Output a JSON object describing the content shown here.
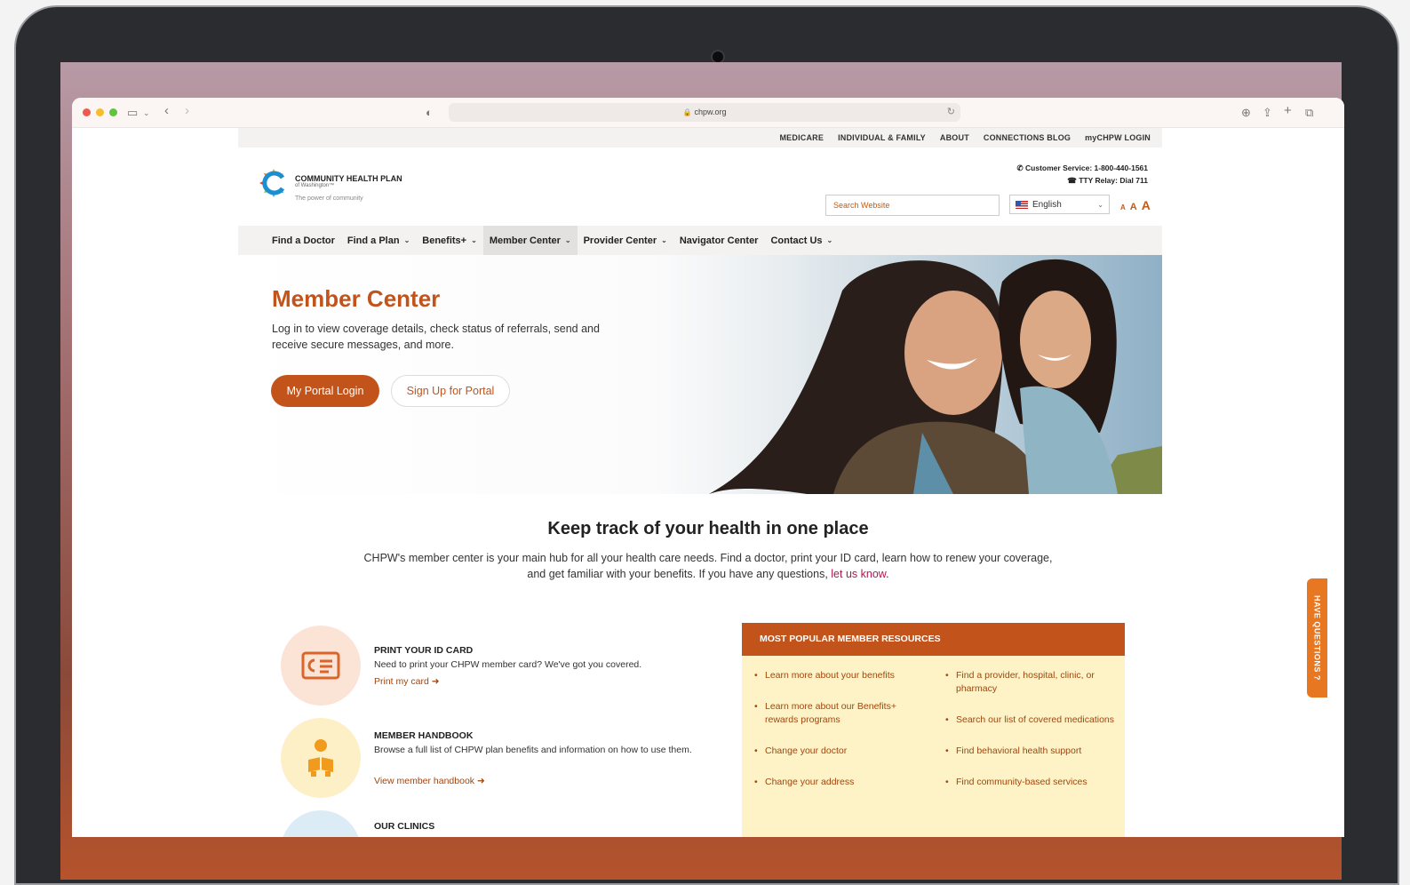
{
  "browser": {
    "url": "chpw.org"
  },
  "utility_nav": [
    "MEDICARE",
    "INDIVIDUAL & FAMILY",
    "ABOUT",
    "CONNECTIONS BLOG",
    "myCHPW LOGIN"
  ],
  "logo": {
    "name": "COMMUNITY HEALTH PLAN",
    "sub": "of Washington™",
    "tagline": "The power of community"
  },
  "contact": {
    "customer_service": "Customer Service: 1-800-440-1561",
    "tty": "TTY Relay: Dial 711"
  },
  "search": {
    "placeholder": "Search Website"
  },
  "language": {
    "selected": "English"
  },
  "text_size": [
    "A",
    "A",
    "A"
  ],
  "main_nav": [
    {
      "label": "Find a Doctor"
    },
    {
      "label": "Find a Plan"
    },
    {
      "label": "Benefits+"
    },
    {
      "label": "Member Center"
    },
    {
      "label": "Provider Center"
    },
    {
      "label": "Navigator Center"
    },
    {
      "label": "Contact Us"
    }
  ],
  "hero": {
    "title": "Member Center",
    "text": "Log in to view coverage details, check status of referrals, send and receive secure messages, and more.",
    "primary_button": "My Portal Login",
    "secondary_button": "Sign Up for Portal"
  },
  "intro": {
    "title": "Keep track of your health in one place",
    "text": "CHPW's member center is your main hub for all your health care needs. Find a doctor, print your ID card, learn how to renew your coverage, and get familiar with your benefits. If you have any questions, ",
    "link": "let us know",
    "end": "."
  },
  "resources": [
    {
      "title": "PRINT YOUR ID CARD",
      "text": "Need to print your CHPW member card? We've got you covered.",
      "link": "Print my card ➜",
      "icon": "id-card-icon"
    },
    {
      "title": "MEMBER HANDBOOK",
      "text": "Browse a full list of CHPW plan benefits and information on how to use them.",
      "link": "View member handbook ➜",
      "icon": "reader-icon"
    },
    {
      "title": "OUR CLINICS",
      "icon": "clinic-icon"
    }
  ],
  "popular": {
    "heading": "MOST POPULAR MEMBER RESOURCES",
    "left": [
      "Learn more about your benefits",
      "Learn more about our Benefits+ rewards programs",
      "Change your doctor",
      "Change your address"
    ],
    "right": [
      "Find a provider, hospital, clinic, or pharmacy",
      "Search our list of covered medications",
      "Find behavioral health support",
      "Find community-based services"
    ]
  },
  "side_tab": "HAVE QUESTIONS ?",
  "colors": {
    "brand": "#c2541b",
    "link": "#a0460f",
    "accent_link": "#b0174f",
    "panel_bg": "#fdf3c6",
    "side_tab": "#e87722"
  }
}
